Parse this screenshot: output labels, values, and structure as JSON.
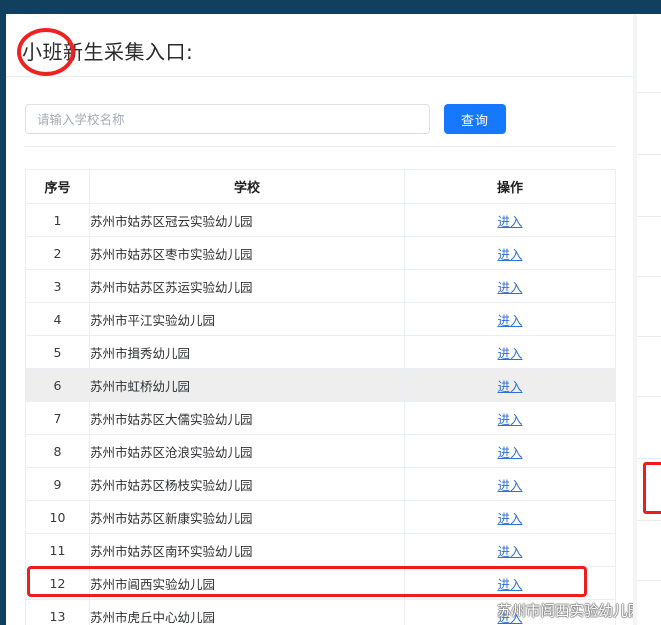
{
  "window": {
    "top_bar_color": "#11405f",
    "accent_color": "#1677ff",
    "annotation_color": "#ee1c1c"
  },
  "page": {
    "title": "小班新生采集入口:"
  },
  "search": {
    "placeholder": "请输入学校名称",
    "value": "",
    "button_label": "查询"
  },
  "table": {
    "headers": {
      "index": "序号",
      "school": "学校",
      "action": "操作"
    },
    "action_label": "进入",
    "rows": [
      {
        "index": "1",
        "school": "苏州市姑苏区冠云实验幼儿园",
        "action": "进入",
        "striped": false,
        "highlighted": false
      },
      {
        "index": "2",
        "school": "苏州市姑苏区枣市实验幼儿园",
        "action": "进入",
        "striped": false,
        "highlighted": false
      },
      {
        "index": "3",
        "school": "苏州市姑苏区苏运实验幼儿园",
        "action": "进入",
        "striped": false,
        "highlighted": false
      },
      {
        "index": "4",
        "school": "苏州市平江实验幼儿园",
        "action": "进入",
        "striped": false,
        "highlighted": false
      },
      {
        "index": "5",
        "school": "苏州市揖秀幼儿园",
        "action": "进入",
        "striped": false,
        "highlighted": false
      },
      {
        "index": "6",
        "school": "苏州市虹桥幼儿园",
        "action": "进入",
        "striped": true,
        "highlighted": false
      },
      {
        "index": "7",
        "school": "苏州市姑苏区大儒实验幼儿园",
        "action": "进入",
        "striped": false,
        "highlighted": false
      },
      {
        "index": "8",
        "school": "苏州市姑苏区沧浪实验幼儿园",
        "action": "进入",
        "striped": false,
        "highlighted": false
      },
      {
        "index": "9",
        "school": "苏州市姑苏区杨枝实验幼儿园",
        "action": "进入",
        "striped": false,
        "highlighted": false
      },
      {
        "index": "10",
        "school": "苏州市姑苏区新康实验幼儿园",
        "action": "进入",
        "striped": false,
        "highlighted": false
      },
      {
        "index": "11",
        "school": "苏州市姑苏区南环实验幼儿园",
        "action": "进入",
        "striped": false,
        "highlighted": false
      },
      {
        "index": "12",
        "school": "苏州市阊西实验幼儿园",
        "action": "进入",
        "striped": false,
        "highlighted": true
      },
      {
        "index": "13",
        "school": "苏州市虎丘中心幼儿园",
        "action": "进入",
        "striped": false,
        "highlighted": false
      }
    ]
  },
  "watermark": {
    "icon": "wechat-icon",
    "text": "苏州市阊西实验幼儿园"
  },
  "annotations": {
    "title_circle": "circle-annotation",
    "row12_rectangle": "rectangle-annotation",
    "right_edge_rectangle": "rectangle-annotation"
  }
}
